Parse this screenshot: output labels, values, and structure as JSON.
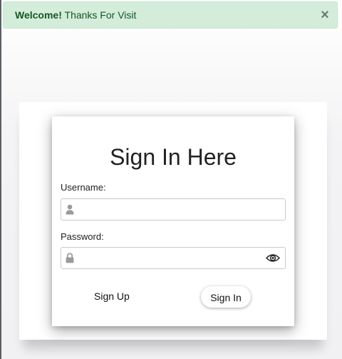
{
  "alert": {
    "strong": "Welcome!",
    "message": " Thanks For Visit",
    "close": "×"
  },
  "form": {
    "title": "Sign In Here",
    "username_label": "Username:",
    "username_value": "",
    "password_label": "Password:",
    "password_value": "",
    "signup_label": "Sign Up",
    "signin_label": "Sign In"
  },
  "icons": {
    "user": "user-icon",
    "lock": "lock-icon",
    "eye": "eye-icon",
    "close": "close-icon"
  },
  "colors": {
    "alert_bg": "#d4edda",
    "alert_text": "#155724",
    "icon_gray": "#9a9a9a"
  }
}
